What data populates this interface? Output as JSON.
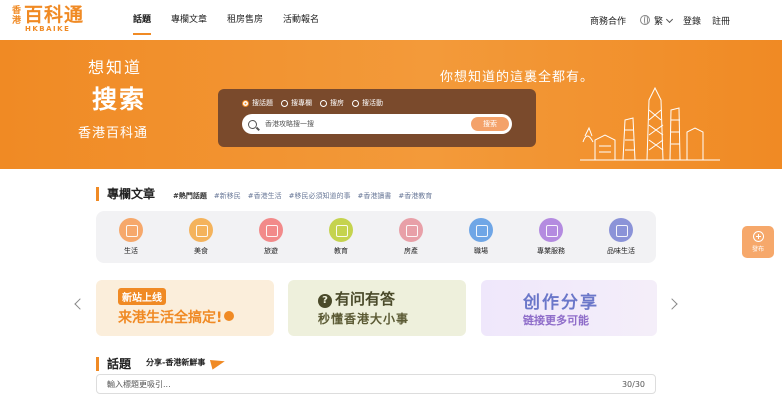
{
  "logo": {
    "side": "香港",
    "main": "百科通",
    "sub": "HKBAIKE"
  },
  "nav": {
    "items": [
      "話題",
      "專欄文章",
      "租房售房",
      "活動報名"
    ]
  },
  "right_nav": {
    "business": "商務合作",
    "lang": "繁",
    "login": "登錄",
    "register": "註冊"
  },
  "hero": {
    "slogan_1": "想知道",
    "slogan_2": "搜索",
    "slogan_3": "香港百科通",
    "slogan_right": "你想知道的這裏全都有。",
    "radios": [
      "搜話題",
      "搜專欄",
      "搜房",
      "搜活動"
    ],
    "search_placeholder": "香港攻略搜一搜",
    "search_button": "搜索"
  },
  "column": {
    "title": "專欄文章",
    "tags": [
      "#熱門話題",
      "#新移民",
      "#香港生活",
      "#移民必須知道的事",
      "#香港讀書",
      "#香港教育"
    ]
  },
  "categories": [
    {
      "label": "生活",
      "color": "#f6a86b"
    },
    {
      "label": "美食",
      "color": "#f4b35c"
    },
    {
      "label": "旅遊",
      "color": "#f28a8a"
    },
    {
      "label": "教育",
      "color": "#c5d34e"
    },
    {
      "label": "房產",
      "color": "#e8a0a8"
    },
    {
      "label": "職場",
      "color": "#6fa6e6"
    },
    {
      "label": "專業服務",
      "color": "#b48be0"
    },
    {
      "label": "品味生活",
      "color": "#8b93d8"
    }
  ],
  "side_button": {
    "label": "發布"
  },
  "banners": {
    "b1_line1": "新站上线",
    "b1_line2": "来港生活全搞定!",
    "b2_q": "?",
    "b2_line1": "有问有答",
    "b2_line2": "秒懂香港大小事",
    "b3_line1": "创作分享",
    "b3_line2": "链接更多可能"
  },
  "topic": {
    "title": "話題",
    "subtitle": "分享-香港新鮮事",
    "input_placeholder": "輸入標題更吸引...",
    "count": "30/30"
  }
}
